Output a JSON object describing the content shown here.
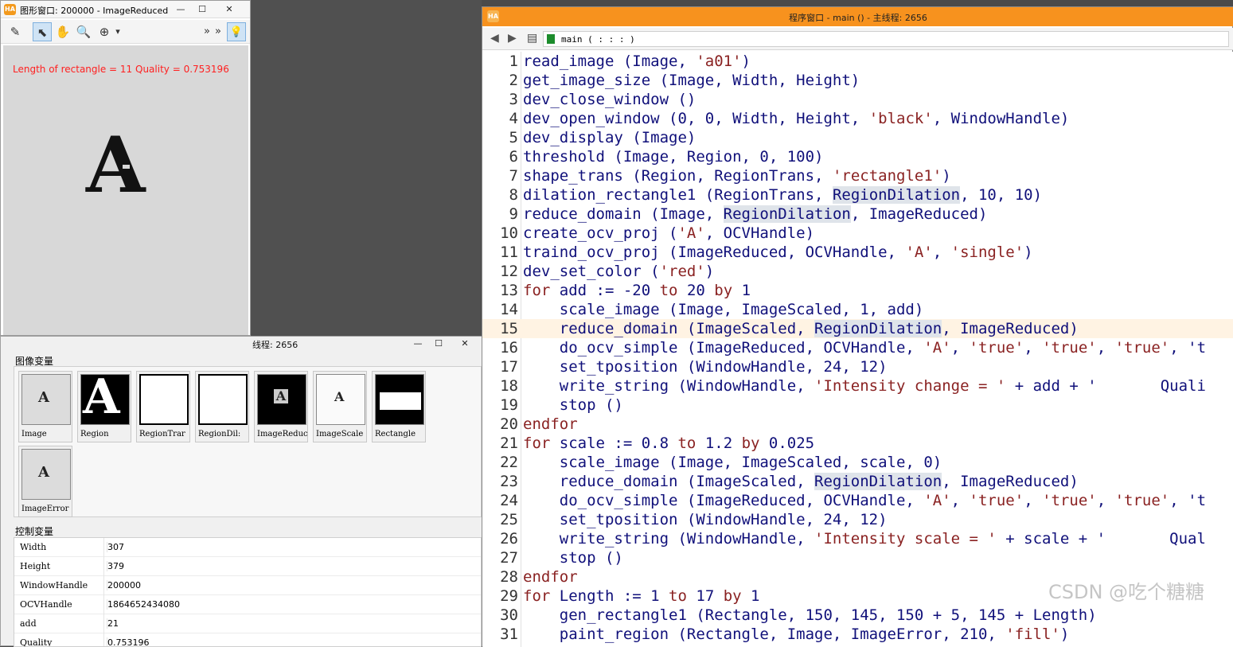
{
  "graphics_window": {
    "app_icon": "HA",
    "title": "图形窗口: 200000 - ImageReduced",
    "buttons": {
      "minimize": "—",
      "maximize": "☐",
      "close": "✕"
    },
    "toolbar": [
      {
        "icon": "edit-icon",
        "glyph": "✎"
      },
      {
        "icon": "pointer-icon",
        "glyph": "⬉"
      },
      {
        "icon": "hand-icon",
        "glyph": "✋"
      },
      {
        "icon": "magnifier-icon",
        "glyph": "🔍"
      },
      {
        "icon": "zoom-in-icon",
        "glyph": "⊕"
      },
      {
        "icon": "dropdown-arrow-icon",
        "glyph": "▾"
      },
      {
        "icon": "overflow-icon",
        "glyph": "»"
      },
      {
        "icon": "overflow-icon-2",
        "glyph": "»"
      },
      {
        "icon": "lightbulb-icon",
        "glyph": "💡"
      }
    ],
    "overlay_text": "Length of rectangle = 11   Quality = 0.753196",
    "image_letter": "A"
  },
  "variable_window": {
    "title_fragment": "线程: 2656",
    "buttons": {
      "minimize": "—",
      "maximize": "☐",
      "close": "✕"
    },
    "iconic_section_label": "图像变量",
    "iconic_vars": [
      {
        "name": "Image",
        "glyph": "A"
      },
      {
        "name": "Region",
        "glyph": "A"
      },
      {
        "name": "RegionTrar",
        "glyph": ""
      },
      {
        "name": "RegionDil:",
        "glyph": ""
      },
      {
        "name": "ImageReduc",
        "glyph": "A"
      },
      {
        "name": "ImageScale",
        "glyph": "A"
      },
      {
        "name": "Rectangle",
        "glyph": ""
      },
      {
        "name": "ImageError",
        "glyph": "A"
      }
    ],
    "control_section_label": "控制变量",
    "control_vars": [
      {
        "name": "Width",
        "value": "307"
      },
      {
        "name": "Height",
        "value": "379"
      },
      {
        "name": "WindowHandle",
        "value": "200000"
      },
      {
        "name": "OCVHandle",
        "value": "1864652434080"
      },
      {
        "name": "add",
        "value": "21"
      },
      {
        "name": "Quality",
        "value": "0.753196"
      }
    ]
  },
  "program_window": {
    "app_icon": "HA",
    "title": "程序窗口 - main () - 主线程: 2656",
    "toolbar": {
      "back": "◀",
      "forward": "▶",
      "procedure_icon": "▤",
      "procedure_label": "main ( : : : )"
    },
    "code": [
      {
        "num": "1",
        "text": "read_image (Image, 'a01')"
      },
      {
        "num": "2",
        "text": "get_image_size (Image, Width, Height)"
      },
      {
        "num": "3",
        "text": "dev_close_window ()"
      },
      {
        "num": "4",
        "text": "dev_open_window (0, 0, Width, Height, 'black', WindowHandle)"
      },
      {
        "num": "5",
        "text": "dev_display (Image)"
      },
      {
        "num": "6",
        "text": "threshold (Image, Region, 0, 100)"
      },
      {
        "num": "7",
        "text": "shape_trans (Region, RegionTrans, 'rectangle1')"
      },
      {
        "num": "8",
        "text": "dilation_rectangle1 (RegionTrans, RegionDilation, 10, 10)"
      },
      {
        "num": "9",
        "text": "reduce_domain (Image, RegionDilation, ImageReduced)"
      },
      {
        "num": "10",
        "text": "create_ocv_proj ('A', OCVHandle)"
      },
      {
        "num": "11",
        "text": "traind_ocv_proj (ImageReduced, OCVHandle, 'A', 'single')"
      },
      {
        "num": "12",
        "text": "dev_set_color ('red')"
      },
      {
        "num": "13",
        "text": "for add := -20 to 20 by 1"
      },
      {
        "num": "14",
        "text": "    scale_image (Image, ImageScaled, 1, add)"
      },
      {
        "num": "15",
        "text": "    reduce_domain (ImageScaled, RegionDilation, ImageReduced)"
      },
      {
        "num": "16",
        "text": "    do_ocv_simple (ImageReduced, OCVHandle, 'A', 'true', 'true', 'true', 't"
      },
      {
        "num": "17",
        "text": "    set_tposition (WindowHandle, 24, 12)"
      },
      {
        "num": "18",
        "text": "    write_string (WindowHandle, 'Intensity change = ' + add + '       Quali"
      },
      {
        "num": "19",
        "text": "    stop ()"
      },
      {
        "num": "20",
        "text": "endfor"
      },
      {
        "num": "21",
        "text": "for scale := 0.8 to 1.2 by 0.025"
      },
      {
        "num": "22",
        "text": "    scale_image (Image, ImageScaled, scale, 0)"
      },
      {
        "num": "23",
        "text": "    reduce_domain (ImageScaled, RegionDilation, ImageReduced)"
      },
      {
        "num": "24",
        "text": "    do_ocv_simple (ImageReduced, OCVHandle, 'A', 'true', 'true', 'true', 't"
      },
      {
        "num": "25",
        "text": "    set_tposition (WindowHandle, 24, 12)"
      },
      {
        "num": "26",
        "text": "    write_string (WindowHandle, 'Intensity scale = ' + scale + '       Qual"
      },
      {
        "num": "27",
        "text": "    stop ()"
      },
      {
        "num": "28",
        "text": "endfor"
      },
      {
        "num": "29",
        "text": "for Length := 1 to 17 by 1"
      },
      {
        "num": "30",
        "text": "    gen_rectangle1 (Rectangle, 150, 145, 150 + 5, 145 + Length)"
      },
      {
        "num": "31",
        "text": "    paint_region (Rectangle, Image, ImageError, 210, 'fill')"
      }
    ],
    "current_line": "15",
    "watermark": "CSDN @吃个糖糖"
  },
  "colors": {
    "accent_orange": "#f7921e",
    "overlay_red": "#ff2020",
    "code_blue": "#10107a",
    "keyword_red": "#8a2222",
    "highlight": "#dfe4ea"
  }
}
